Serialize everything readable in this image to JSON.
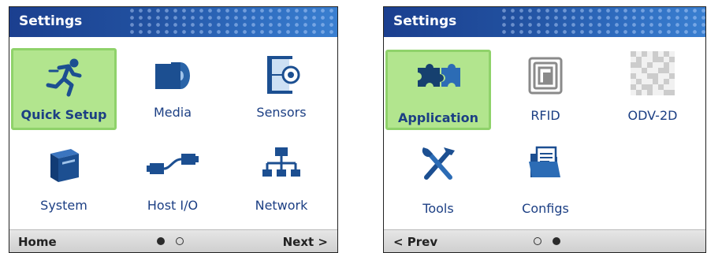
{
  "left_screen": {
    "title": "Settings",
    "tiles": [
      {
        "label": "Quick Setup",
        "icon": "running-person-icon",
        "selected": true
      },
      {
        "label": "Media",
        "icon": "media-roll-icon",
        "selected": false
      },
      {
        "label": "Sensors",
        "icon": "sensor-icon",
        "selected": false
      },
      {
        "label": "System",
        "icon": "printer-icon",
        "selected": false
      },
      {
        "label": "Host I/O",
        "icon": "cable-connector-icon",
        "selected": false
      },
      {
        "label": "Network",
        "icon": "network-icon",
        "selected": false
      }
    ],
    "bottom": {
      "left": "Home",
      "right": "Next >",
      "page_indicator": {
        "current": 1,
        "total": 2
      }
    }
  },
  "right_screen": {
    "title": "Settings",
    "tiles": [
      {
        "label": "Application",
        "icon": "puzzle-icon",
        "selected": true
      },
      {
        "label": "RFID",
        "icon": "rfid-chip-icon",
        "selected": false
      },
      {
        "label": "ODV-2D",
        "icon": "barcode-2d-icon",
        "selected": false
      },
      {
        "label": "Tools",
        "icon": "tools-icon",
        "selected": false
      },
      {
        "label": "Configs",
        "icon": "folder-icon",
        "selected": false
      }
    ],
    "bottom": {
      "left": "< Prev",
      "page_indicator": {
        "current": 2,
        "total": 2
      }
    }
  },
  "colors": {
    "title_bar": "#21509f",
    "selected_tile": "#b2e58e",
    "selected_border": "#8fd26a",
    "icon_blue": "#1c4f91",
    "label_text": "#1c3f84"
  }
}
